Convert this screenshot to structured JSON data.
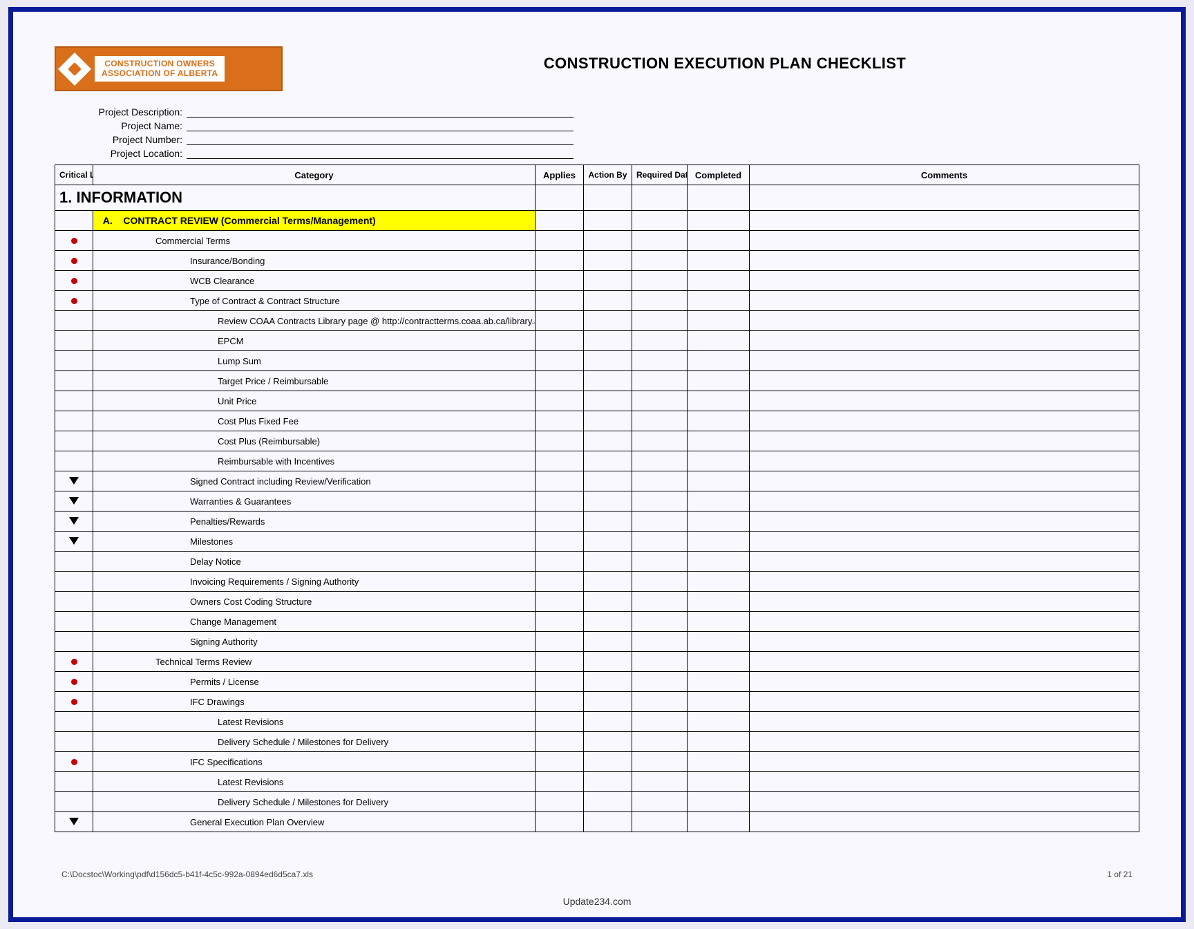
{
  "logo": {
    "line1": "CONSTRUCTION OWNERS",
    "line2": "ASSOCIATION OF ALBERTA"
  },
  "title": "CONSTRUCTION EXECUTION PLAN CHECKLIST",
  "meta": {
    "labels": {
      "description": "Project Description:",
      "name": "Project Name:",
      "number": "Project Number:",
      "location": "Project Location:"
    }
  },
  "columns": {
    "critical": "Critical Level",
    "category": "Category",
    "applies": "Applies",
    "action": "Action By",
    "required": "Required Date",
    "completed": "Completed",
    "comments": "Comments"
  },
  "section": {
    "number": "1.",
    "title": "INFORMATION"
  },
  "subsection": {
    "letter": "A.",
    "title": "CONTRACT REVIEW (Commercial Terms/Management)"
  },
  "rows": [
    {
      "mark": "red",
      "indent": 1,
      "text": "Commercial Terms"
    },
    {
      "mark": "red",
      "indent": 2,
      "text": "Insurance/Bonding"
    },
    {
      "mark": "red",
      "indent": 2,
      "text": "WCB Clearance"
    },
    {
      "mark": "red",
      "indent": 2,
      "text": "Type of Contract & Contract Structure"
    },
    {
      "mark": "",
      "indent": 3,
      "text": "Review COAA Contracts Library page @ http://contractterms.coaa.ab.ca/library.asp"
    },
    {
      "mark": "",
      "indent": 3,
      "text": "EPCM"
    },
    {
      "mark": "",
      "indent": 3,
      "text": "Lump Sum"
    },
    {
      "mark": "",
      "indent": 3,
      "text": "Target Price / Reimbursable"
    },
    {
      "mark": "",
      "indent": 3,
      "text": "Unit Price"
    },
    {
      "mark": "",
      "indent": 3,
      "text": "Cost Plus Fixed Fee"
    },
    {
      "mark": "",
      "indent": 3,
      "text": "Cost Plus (Reimbursable)"
    },
    {
      "mark": "",
      "indent": 3,
      "text": "Reimbursable with Incentives"
    },
    {
      "mark": "arrow",
      "indent": 2,
      "text": "Signed Contract including Review/Verification"
    },
    {
      "mark": "arrow",
      "indent": 2,
      "text": "Warranties & Guarantees"
    },
    {
      "mark": "arrow",
      "indent": 2,
      "text": "Penalties/Rewards"
    },
    {
      "mark": "arrow",
      "indent": 2,
      "text": "Milestones"
    },
    {
      "mark": "",
      "indent": 2,
      "text": "Delay Notice"
    },
    {
      "mark": "",
      "indent": 2,
      "text": "Invoicing Requirements / Signing Authority"
    },
    {
      "mark": "",
      "indent": 2,
      "text": "Owners Cost Coding Structure"
    },
    {
      "mark": "",
      "indent": 2,
      "text": "Change Management"
    },
    {
      "mark": "",
      "indent": 2,
      "text": "Signing Authority"
    },
    {
      "mark": "red",
      "indent": 1,
      "text": "Technical Terms Review"
    },
    {
      "mark": "red",
      "indent": 2,
      "text": "Permits / License"
    },
    {
      "mark": "red",
      "indent": 2,
      "text": "IFC Drawings"
    },
    {
      "mark": "",
      "indent": 3,
      "text": "Latest Revisions"
    },
    {
      "mark": "",
      "indent": 3,
      "text": "Delivery Schedule / Milestones for Delivery"
    },
    {
      "mark": "red",
      "indent": 2,
      "text": "IFC Specifications"
    },
    {
      "mark": "",
      "indent": 3,
      "text": "Latest Revisions"
    },
    {
      "mark": "",
      "indent": 3,
      "text": "Delivery Schedule / Milestones for Delivery"
    },
    {
      "mark": "arrow",
      "indent": 2,
      "text": "General Execution Plan Overview"
    }
  ],
  "footer": {
    "path": "C:\\Docstoc\\Working\\pdf\\d156dc5-b41f-4c5c-992a-0894ed6d5ca7.xls",
    "page": "1 of 21",
    "watermark": "Update234.com"
  }
}
